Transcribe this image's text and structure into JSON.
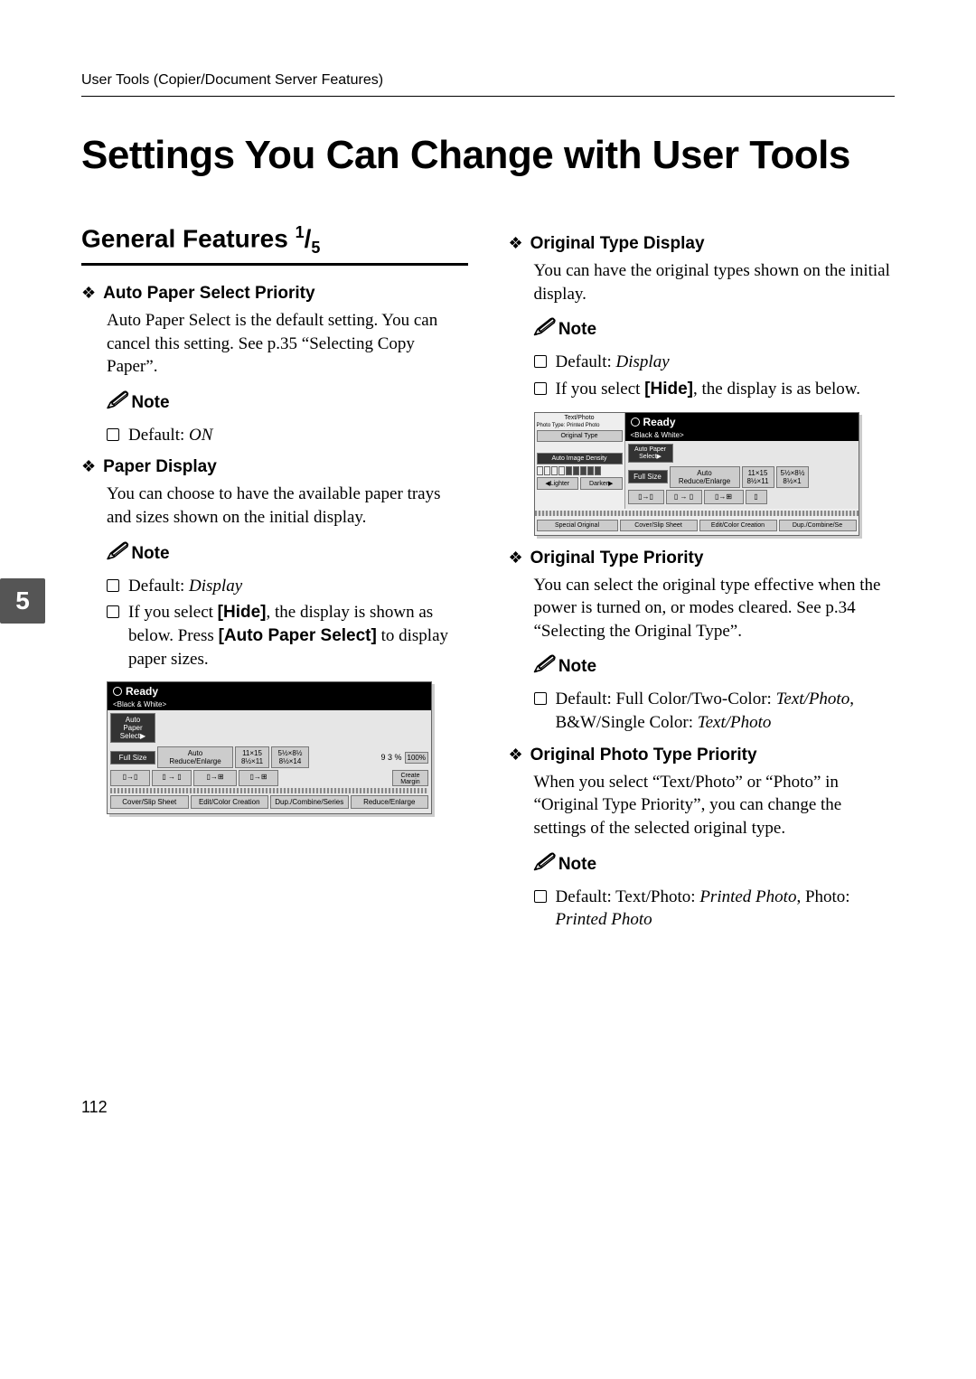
{
  "header": "User Tools (Copier/Document Server Features)",
  "main_title": "Settings You Can Change with User Tools",
  "sidebar_tab": "5",
  "page_number": "112",
  "left": {
    "section_title": "General Features ",
    "section_fraction_num": "1",
    "section_fraction_den": "5",
    "h1": {
      "label": "Auto Paper Select Priority",
      "body": "Auto Paper Select is the default setting. You can cancel this setting. See p.35 “Selecting Copy Paper”.",
      "note_label": "Note",
      "b1_prefix": "Default: ",
      "b1_italic": "ON"
    },
    "h2": {
      "label": "Paper Display",
      "body": "You can choose to have the available paper trays and sizes shown on the initial display.",
      "note_label": "Note",
      "b1_prefix": "Default: ",
      "b1_italic": "Display",
      "b2_prefix": "If you select ",
      "b2_bold": "[Hide]",
      "b2_mid": ", the display is shown as below. Press ",
      "b2_bold2": "[Auto Paper Select]",
      "b2_suffix": " to display paper sizes."
    }
  },
  "right": {
    "h1": {
      "label": "Original Type Display",
      "body": "You can have the original types shown on the initial display.",
      "note_label": "Note",
      "b1_prefix": "Default: ",
      "b1_italic": "Display",
      "b2_prefix": "If you select ",
      "b2_bold": "[Hide]",
      "b2_suffix": ", the display is as below."
    },
    "h2": {
      "label": "Original Type Priority",
      "body": "You can select the original type effective when the power is turned on, or modes cleared. See p.34 “Selecting the Original Type”.",
      "note_label": "Note",
      "b1_prefix": "Default: Full Color/Two-Color: ",
      "b1_italic1": "Text/Photo",
      "b1_mid": ", B&W/Single Color: ",
      "b1_italic2": "Text/Photo"
    },
    "h3": {
      "label": "Original Photo Type Priority",
      "body": "When you select “Text/Photo” or “Photo” in “Original Type Priority”, you can change the settings of the selected original type.",
      "note_label": "Note",
      "b1_prefix": "Default: Text/Photo: ",
      "b1_italic1": "Printed Photo",
      "b1_mid": ", Photo: ",
      "b1_italic2": "Printed Photo"
    }
  },
  "ss1": {
    "ready": "Ready",
    "bw": "<Black & White>",
    "auto_paper": "Auto Paper",
    "select_arrow": "Select▶",
    "full_size": "Full Size",
    "are": "Auto Reduce/Enlarge",
    "s1": "11×15",
    "s1b": "8½×11",
    "s2": "5½×8½",
    "s2b": "8½×14",
    "pct": "9 3 %",
    "pct100": "100%",
    "create_margin": "Create Margin",
    "cover": "Cover/Slip Sheet",
    "edit": "Edit/Color Creation",
    "dup": "Dup./Combine/Series",
    "reduce": "Reduce/Enlarge"
  },
  "ss2": {
    "ready": "Ready",
    "bw": "<Black & White>",
    "textphoto": "Text/Photo",
    "photo_type": "Photo Type: Printed Photo",
    "original_type": "Original Type",
    "auto_paper": "Auto Paper",
    "select_arrow": "Select▶",
    "aid": "Auto Image Density",
    "full_size": "Full Size",
    "are": "Auto Reduce/Enlarge",
    "s1": "11×15",
    "s1b": "8½×11",
    "s2": "5½×8½",
    "s2b": "8½×1",
    "lighter": "◀Lighter",
    "darker": "Darker▶",
    "special": "Special Original",
    "cover": "Cover/Slip Sheet",
    "edit": "Edit/Color Creation",
    "dup": "Dup./Combine/Se"
  }
}
